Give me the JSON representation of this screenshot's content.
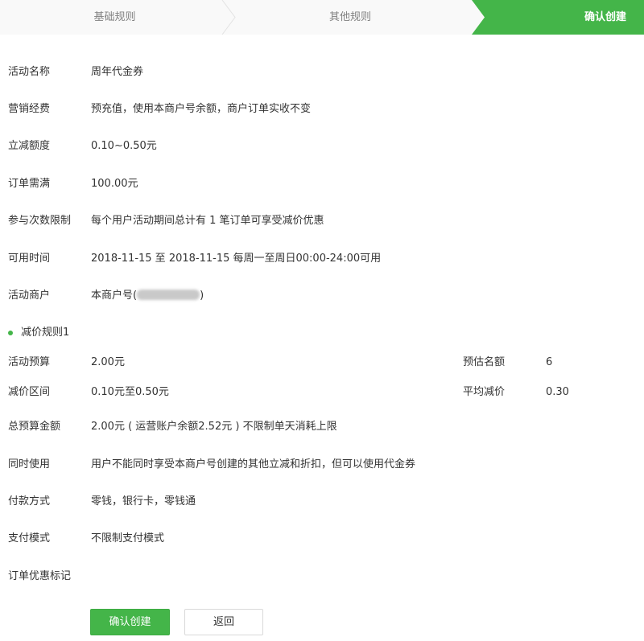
{
  "steps": [
    {
      "label": "基础规则",
      "state": "done"
    },
    {
      "label": "其他规则",
      "state": "done"
    },
    {
      "label": "确认创建",
      "state": "active"
    }
  ],
  "colors": {
    "accent": "#44b549",
    "step_inactive": "#f9f9f9",
    "border": "#e6e6e6"
  },
  "details": {
    "activity_name": {
      "label": "活动名称",
      "value": "周年代金券"
    },
    "marketing_fee": {
      "label": "营销经费",
      "value": "预充值，使用本商户号余额，商户订单实收不变"
    },
    "discount_amount": {
      "label": "立减额度",
      "value": "0.10~0.50元"
    },
    "order_threshold": {
      "label": "订单需满",
      "value": "100.00元"
    },
    "participation_limit": {
      "label": "参与次数限制",
      "value": "每个用户活动期间总计有 1 笔订单可享受减价优惠"
    },
    "available_time": {
      "label": "可用时间",
      "value": "2018-11-15 至 2018-11-15 每周一至周日00:00-24:00可用"
    },
    "merchant": {
      "label": "活动商户",
      "value_prefix": "本商户号(",
      "value_suffix": ")"
    }
  },
  "rule": {
    "title": "减价规则1",
    "budget": {
      "label": "活动预算",
      "value": "2.00元"
    },
    "estimated_quota": {
      "label": "预估名额",
      "value": "6"
    },
    "range": {
      "label": "减价区间",
      "value": "0.10元至0.50元"
    },
    "avg_discount": {
      "label": "平均减价",
      "value": "0.30"
    }
  },
  "summary": {
    "total_budget": {
      "label": "总预算金额",
      "value": "2.00元 ( 运营账户余额2.52元 )  不限制单天消耗上限"
    },
    "concurrent_use": {
      "label": "同时使用",
      "value": "用户不能同时享受本商户号创建的其他立减和折扣，但可以使用代金券"
    },
    "payment_method": {
      "label": "付款方式",
      "value": "零钱，银行卡，零钱通"
    },
    "payment_mode": {
      "label": "支付模式",
      "value": "不限制支付模式"
    },
    "order_tag": {
      "label": "订单优惠标记",
      "value": ""
    }
  },
  "buttons": {
    "confirm": "确认创建",
    "back": "返回"
  }
}
